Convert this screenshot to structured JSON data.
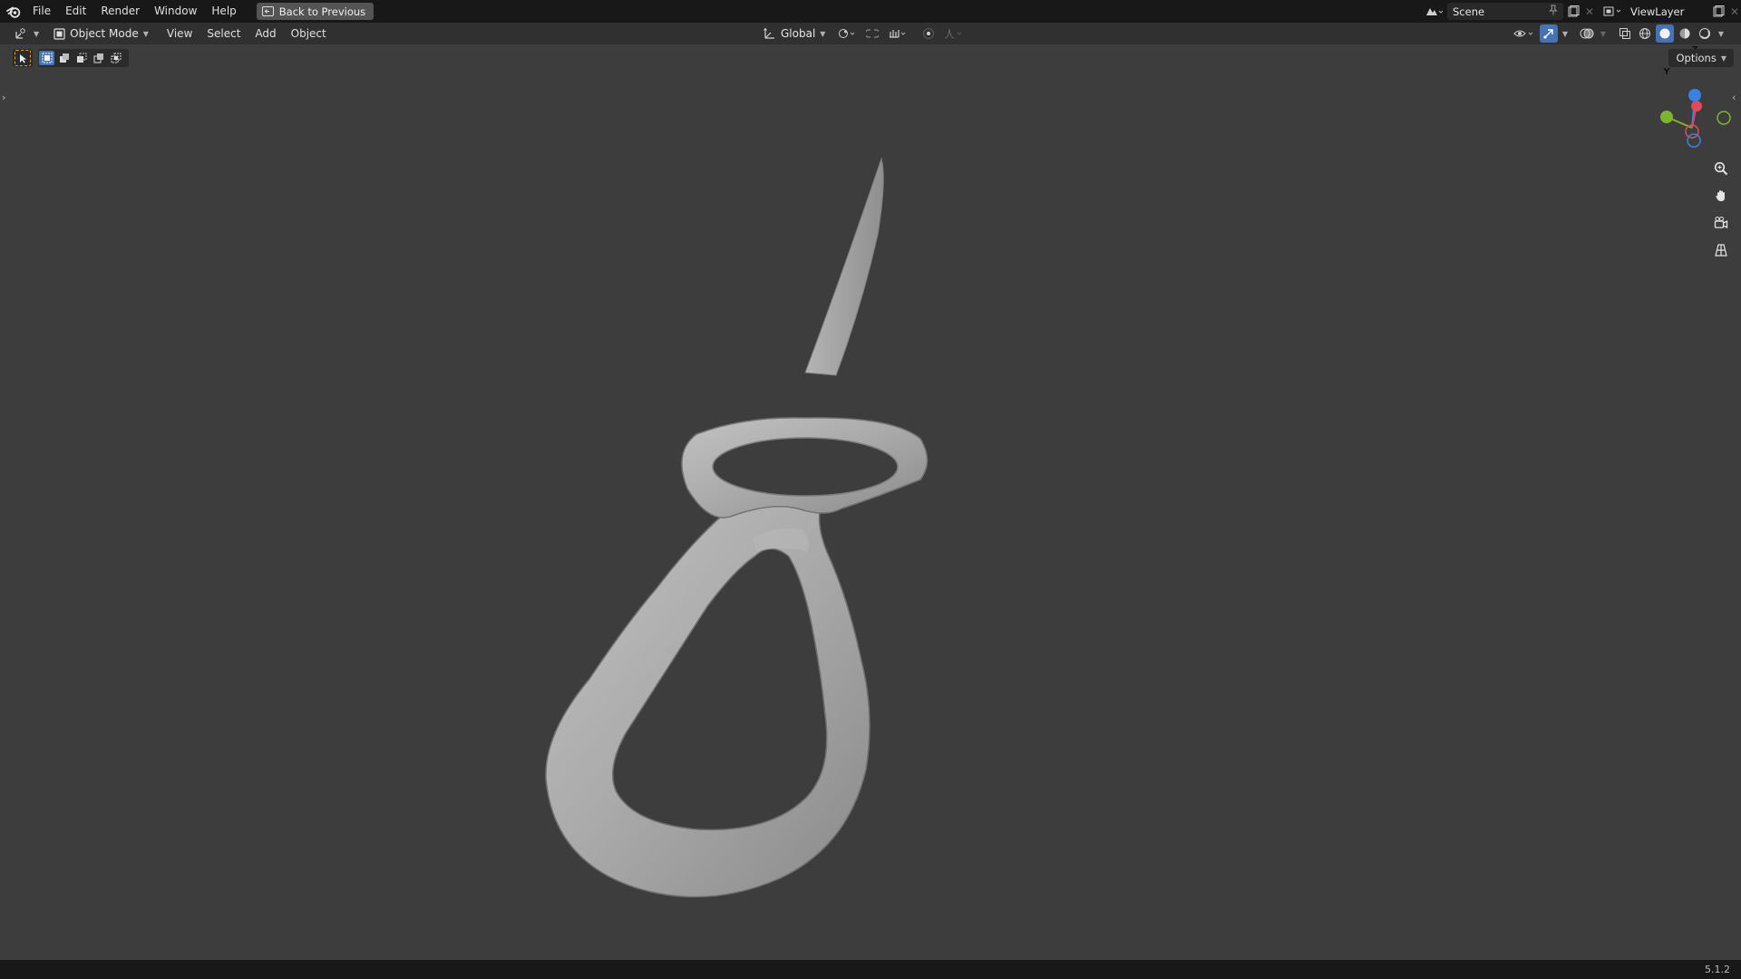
{
  "topbar": {
    "menus": [
      "File",
      "Edit",
      "Render",
      "Window",
      "Help"
    ],
    "back_label": "Back to Previous",
    "scene_label": "Scene",
    "viewlayer_label": "ViewLayer"
  },
  "header": {
    "mode_label": "Object Mode",
    "menus": [
      "View",
      "Select",
      "Add",
      "Object"
    ],
    "transform_orientation": "Global"
  },
  "toolrow": {
    "options_label": "Options"
  },
  "gizmo": {
    "axis_z": "Z",
    "axis_y": "Y",
    "colors": {
      "x": "#e04a5a",
      "y": "#7fb42d",
      "z": "#3b82e0"
    }
  },
  "status": {
    "version": "5.1.2"
  },
  "colors": {
    "viewport_bg": "#3d3d3d",
    "topbar_bg": "#181818",
    "header_bg": "#303030",
    "accent": "#4772b3"
  }
}
